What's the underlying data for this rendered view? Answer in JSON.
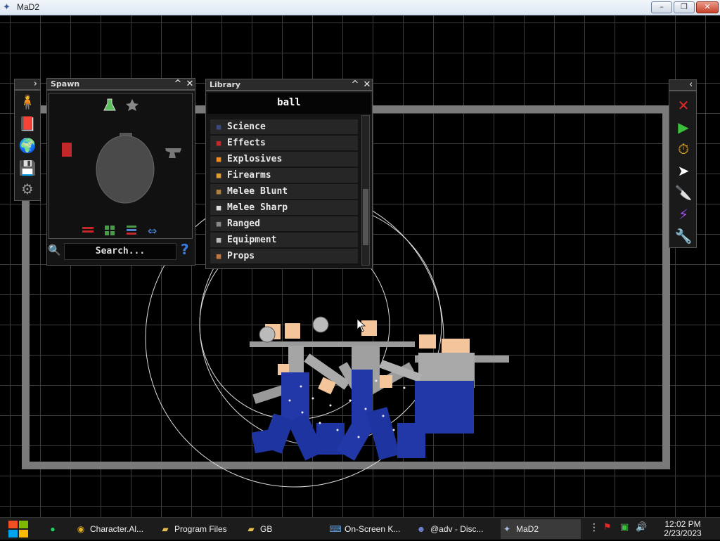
{
  "window": {
    "title": "MaD2",
    "min": "–",
    "max": "❐",
    "close": "✕"
  },
  "spawn": {
    "title": "Spawn",
    "collapse": "^",
    "close": "✕",
    "search_label": "Search...",
    "help": "?"
  },
  "library": {
    "title": "Library",
    "collapse": "^",
    "close": "✕",
    "search_value": "ball",
    "items": [
      {
        "label": "Science",
        "icon": "science-icon",
        "color": "#3b4a7a"
      },
      {
        "label": "Effects",
        "icon": "effects-icon",
        "color": "#c0282a"
      },
      {
        "label": "Explosives",
        "icon": "flame-icon",
        "color": "#f08a1e"
      },
      {
        "label": "Firearms",
        "icon": "bullet-icon",
        "color": "#e0a030"
      },
      {
        "label": "Melee Blunt",
        "icon": "bat-icon",
        "color": "#b08040"
      },
      {
        "label": "Melee Sharp",
        "icon": "blade-icon",
        "color": "#dddddd"
      },
      {
        "label": "Ranged",
        "icon": "bow-icon",
        "color": "#888888"
      },
      {
        "label": "Equipment",
        "icon": "shield-icon",
        "color": "#bbbbbb"
      },
      {
        "label": "Props",
        "icon": "crate-icon",
        "color": "#c07840"
      }
    ]
  },
  "left_toolbar": {
    "expand": "›",
    "icons": [
      "ragdoll-icon",
      "book-icon",
      "globe-icon",
      "save-icon",
      "gear-icon"
    ]
  },
  "right_toolbar": {
    "collapse": "‹",
    "icons": [
      "delete-icon",
      "play-icon",
      "stopwatch-icon",
      "cursor-icon",
      "knife-icon",
      "lightning-icon",
      "wrench-icon"
    ]
  },
  "taskbar": {
    "tasks": [
      {
        "label": "Character.Al...",
        "icon": "chrome-icon"
      },
      {
        "label": "Program Files",
        "icon": "folder-icon"
      },
      {
        "label": "GB",
        "icon": "folder-icon"
      },
      {
        "label": "On-Screen K...",
        "icon": "keyboard-icon"
      },
      {
        "label": "@adv - Disc...",
        "icon": "discord-icon"
      },
      {
        "label": "MaD2",
        "icon": "mad2-icon"
      }
    ],
    "time": "12:02 PM",
    "date": "2/23/2023"
  }
}
